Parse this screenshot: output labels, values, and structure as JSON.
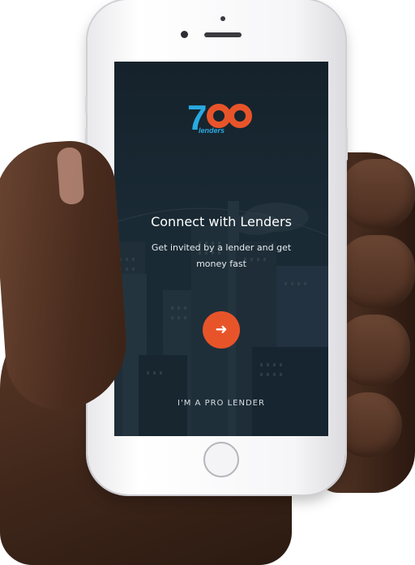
{
  "app": {
    "logo": {
      "number_text": "7",
      "sub_text": "lenders"
    },
    "title": "Connect with Lenders",
    "subtitle": "Get invited by a lender and get money fast",
    "next_button_icon": "arrow-right-icon",
    "next_button_glyph": "➜",
    "pro_lender_link": "I'M A PRO LENDER"
  },
  "colors": {
    "accent": "#e8542a",
    "brand_blue": "#29a9e0",
    "screen_bg": "#15222b"
  }
}
